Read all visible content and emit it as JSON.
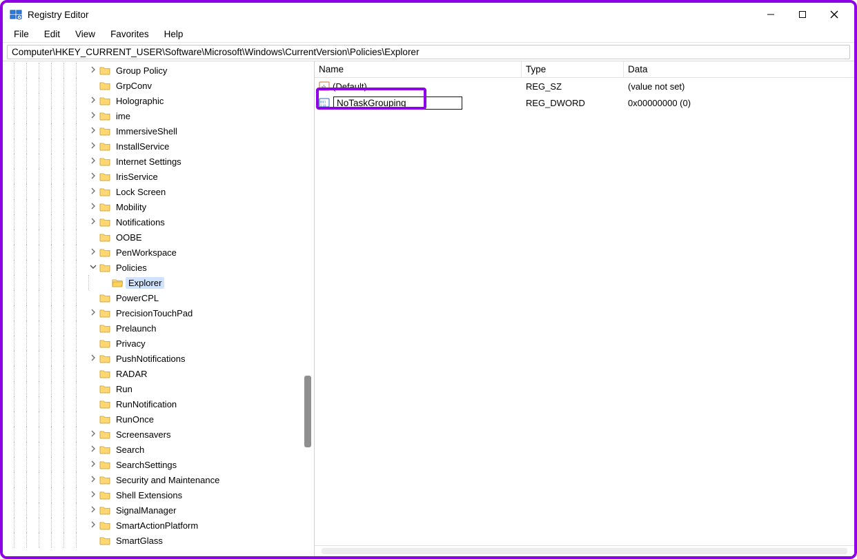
{
  "window": {
    "title": "Registry Editor"
  },
  "menus": [
    "File",
    "Edit",
    "View",
    "Favorites",
    "Help"
  ],
  "address": "Computer\\HKEY_CURRENT_USER\\Software\\Microsoft\\Windows\\CurrentVersion\\Policies\\Explorer",
  "tree": [
    {
      "depth": 6,
      "expander": ">",
      "label": "Group Policy"
    },
    {
      "depth": 6,
      "expander": "",
      "label": "GrpConv"
    },
    {
      "depth": 6,
      "expander": ">",
      "label": "Holographic"
    },
    {
      "depth": 6,
      "expander": ">",
      "label": "ime"
    },
    {
      "depth": 6,
      "expander": ">",
      "label": "ImmersiveShell"
    },
    {
      "depth": 6,
      "expander": ">",
      "label": "InstallService"
    },
    {
      "depth": 6,
      "expander": ">",
      "label": "Internet Settings"
    },
    {
      "depth": 6,
      "expander": ">",
      "label": "IrisService"
    },
    {
      "depth": 6,
      "expander": ">",
      "label": "Lock Screen"
    },
    {
      "depth": 6,
      "expander": ">",
      "label": "Mobility"
    },
    {
      "depth": 6,
      "expander": ">",
      "label": "Notifications"
    },
    {
      "depth": 6,
      "expander": "",
      "label": "OOBE"
    },
    {
      "depth": 6,
      "expander": ">",
      "label": "PenWorkspace"
    },
    {
      "depth": 6,
      "expander": "v",
      "label": "Policies"
    },
    {
      "depth": 7,
      "expander": "",
      "label": "Explorer",
      "selected": true
    },
    {
      "depth": 6,
      "expander": "",
      "label": "PowerCPL"
    },
    {
      "depth": 6,
      "expander": ">",
      "label": "PrecisionTouchPad"
    },
    {
      "depth": 6,
      "expander": "",
      "label": "Prelaunch"
    },
    {
      "depth": 6,
      "expander": "",
      "label": "Privacy"
    },
    {
      "depth": 6,
      "expander": ">",
      "label": "PushNotifications"
    },
    {
      "depth": 6,
      "expander": "",
      "label": "RADAR"
    },
    {
      "depth": 6,
      "expander": "",
      "label": "Run"
    },
    {
      "depth": 6,
      "expander": "",
      "label": "RunNotification"
    },
    {
      "depth": 6,
      "expander": "",
      "label": "RunOnce"
    },
    {
      "depth": 6,
      "expander": ">",
      "label": "Screensavers"
    },
    {
      "depth": 6,
      "expander": ">",
      "label": "Search"
    },
    {
      "depth": 6,
      "expander": ">",
      "label": "SearchSettings"
    },
    {
      "depth": 6,
      "expander": ">",
      "label": "Security and Maintenance"
    },
    {
      "depth": 6,
      "expander": ">",
      "label": "Shell Extensions"
    },
    {
      "depth": 6,
      "expander": ">",
      "label": "SignalManager"
    },
    {
      "depth": 6,
      "expander": ">",
      "label": "SmartActionPlatform"
    },
    {
      "depth": 6,
      "expander": "",
      "label": "SmartGlass"
    }
  ],
  "columns": {
    "name": "Name",
    "type": "Type",
    "data": "Data"
  },
  "values": [
    {
      "icon": "sz",
      "name": "(Default)",
      "type": "REG_SZ",
      "data": "(value not set)"
    },
    {
      "icon": "dword",
      "name": "NoTaskGrouping",
      "type": "REG_DWORD",
      "data": "0x00000000 (0)",
      "editing": true
    }
  ]
}
